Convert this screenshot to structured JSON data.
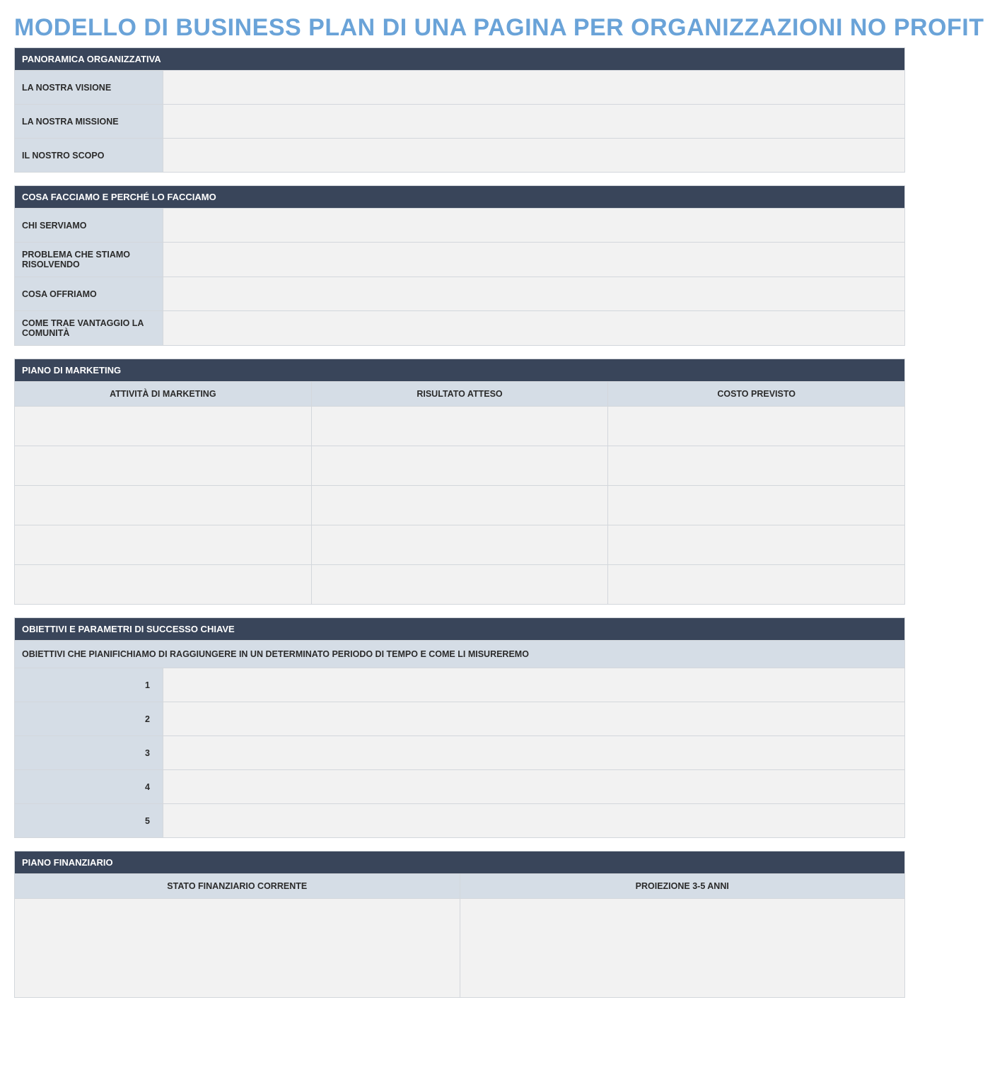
{
  "title": "MODELLO DI BUSINESS PLAN DI UNA PAGINA PER ORGANIZZAZIONI NO PROFIT",
  "section1": {
    "header": "PANORAMICA ORGANIZZATIVA",
    "rows": [
      {
        "label": "LA NOSTRA VISIONE",
        "value": ""
      },
      {
        "label": "LA NOSTRA MISSIONE",
        "value": ""
      },
      {
        "label": "IL NOSTRO SCOPO",
        "value": ""
      }
    ]
  },
  "section2": {
    "header": "COSA FACCIAMO E PERCHÉ LO FACCIAMO",
    "rows": [
      {
        "label": "CHI SERVIAMO",
        "value": ""
      },
      {
        "label": "PROBLEMA CHE STIAMO RISOLVENDO",
        "value": ""
      },
      {
        "label": "COSA OFFRIAMO",
        "value": ""
      },
      {
        "label": "COME TRAE VANTAGGIO LA COMUNITÀ",
        "value": ""
      }
    ]
  },
  "section3": {
    "header": "PIANO DI MARKETING",
    "columns": [
      "ATTIVITÀ DI MARKETING",
      "RISULTATO ATTESO",
      "COSTO PREVISTO"
    ],
    "rows": [
      {
        "activity": "",
        "result": "",
        "cost": ""
      },
      {
        "activity": "",
        "result": "",
        "cost": ""
      },
      {
        "activity": "",
        "result": "",
        "cost": ""
      },
      {
        "activity": "",
        "result": "",
        "cost": ""
      },
      {
        "activity": "",
        "result": "",
        "cost": ""
      }
    ]
  },
  "section4": {
    "header": "OBIETTIVI E PARAMETRI DI SUCCESSO CHIAVE",
    "description": "OBIETTIVI CHE PIANIFICHIAMO DI RAGGIUNGERE IN UN DETERMINATO PERIODO DI TEMPO E COME LI MISUREREMO",
    "rows": [
      {
        "num": "1",
        "value": ""
      },
      {
        "num": "2",
        "value": ""
      },
      {
        "num": "3",
        "value": ""
      },
      {
        "num": "4",
        "value": ""
      },
      {
        "num": "5",
        "value": ""
      }
    ]
  },
  "section5": {
    "header": "PIANO FINANZIARIO",
    "columns": [
      "STATO FINANZIARIO CORRENTE",
      "PROIEZIONE 3-5 ANNI"
    ],
    "current": "",
    "projection": ""
  }
}
